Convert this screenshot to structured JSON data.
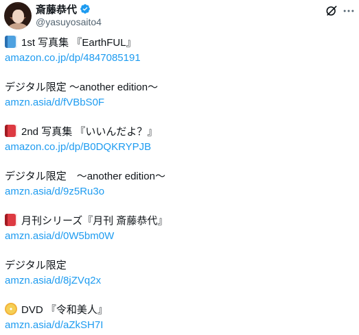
{
  "author": {
    "display_name": "斎藤恭代",
    "handle": "@yasuyosaito4"
  },
  "icons": {
    "verified": "verified-badge-icon",
    "grok": "grok-icon",
    "more": "more-options-icon",
    "blue_book": "blue-book-emoji",
    "red_book": "red-book-emoji",
    "dvd": "dvd-emoji"
  },
  "colors": {
    "link": "#1d9bf0",
    "verified": "#1d9bf0",
    "text": "#0f1419",
    "secondary": "#536471"
  },
  "post": {
    "sections": [
      {
        "title": "1st 写真集 『EarthFUL』",
        "link": "amazon.co.jp/dp/4847085191"
      },
      {
        "title": "デジタル限定 ～another edition～",
        "link": "amzn.asia/d/fVBbS0F"
      },
      {
        "title": "2nd 写真集 『いいんだよ？』",
        "link": "amazon.co.jp/dp/B0DQKRYPJB"
      },
      {
        "title": "デジタル限定　～another edition～",
        "link": "amzn.asia/d/9z5Ru3o"
      },
      {
        "title": "月刊シリーズ『月刊 斎藤恭代』",
        "link": "amzn.asia/d/0W5bm0W"
      },
      {
        "title": "デジタル限定",
        "link": "amzn.asia/d/8jZVq2x"
      },
      {
        "title": "DVD 『令和美人』",
        "link": "amzn.asia/d/aZkSH7I"
      }
    ]
  }
}
